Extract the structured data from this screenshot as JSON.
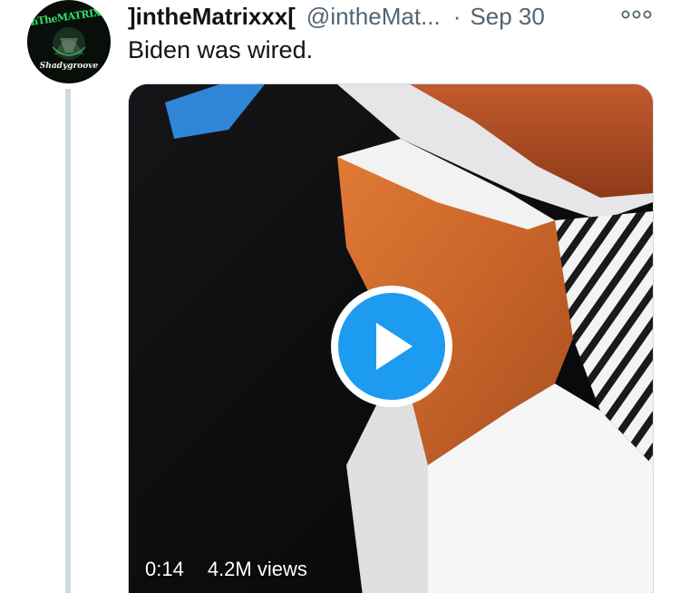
{
  "tweet": {
    "author": {
      "display_name": "]intheMatrixxx[",
      "handle": "@intheMat...",
      "avatar_text": "inTheMATRIXXX",
      "avatar_subtext": "Shadygroove"
    },
    "separator": "·",
    "timestamp": "Sep 30",
    "text": "Biden was wired.",
    "more_icon": "ellipsis-icon",
    "media": {
      "type": "video",
      "duration": "0:14",
      "views": "4.2M views",
      "play_icon": "play-icon"
    }
  },
  "colors": {
    "accent": "#1d9bf0",
    "text_primary": "#0f1419",
    "text_secondary": "#536471",
    "thread_line": "#cfd9de"
  }
}
